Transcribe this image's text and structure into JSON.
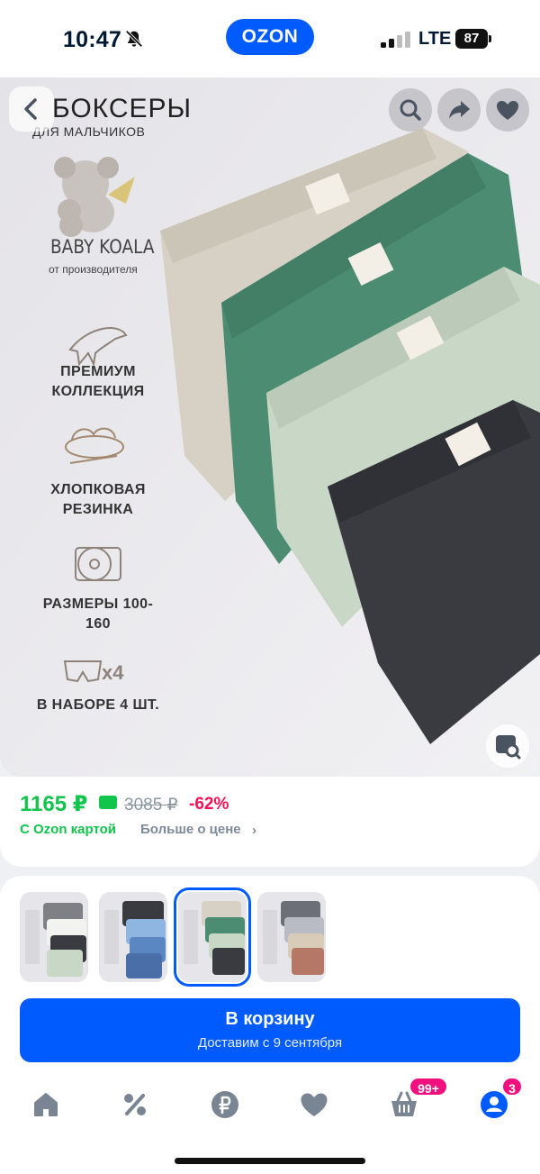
{
  "status_bar": {
    "time": "10:47",
    "network": "LTE",
    "battery": "87",
    "icons": [
      "bell-muted-icon",
      "signal-icon"
    ]
  },
  "app": {
    "logo_text": "OZON"
  },
  "gallery": {
    "title": "БОКСЕРЫ",
    "subtitle": "ДЛЯ МАЛЬЧИКОВ",
    "brand": "BABY KOALA",
    "brand_sub": "от производителя",
    "features": [
      {
        "text": "ПРЕМИУМ КОЛЛЕКЦИЯ",
        "icon": "dinosaur-icon"
      },
      {
        "text": "ХЛОПКОВАЯ РЕЗИНКА",
        "icon": "cotton-icon"
      },
      {
        "text": "РАЗМЕРЫ 100-160",
        "icon": "measuring-tape-icon"
      },
      {
        "text": "В НАБОРЕ 4 ШТ.",
        "icon": "briefs-icon",
        "count_label": "x4"
      }
    ],
    "product_colors": [
      "#d6d1c4",
      "#4b8c72",
      "#c9d7c6",
      "#3a3b40"
    ],
    "actions": [
      "back-icon",
      "search-icon",
      "share-icon",
      "heart-icon",
      "visual-search-icon"
    ]
  },
  "price": {
    "current": "1165 ₽",
    "old": "3085 ₽",
    "discount": "-62%",
    "card_label": "С Ozon картой",
    "more_label": "Больше о цене",
    "colors": {
      "ozon_green": "#10c44c",
      "discount_red": "#f91155"
    }
  },
  "variants": {
    "items": [
      {
        "colors": [
          "#7e8086",
          "#f2f2f0",
          "#c9d7c6",
          "#3a3b40"
        ]
      },
      {
        "colors": [
          "#3a3b40",
          "#8fb6e0",
          "#5a86c2",
          "#4a6fa8"
        ]
      },
      {
        "colors": [
          "#d6d1c4",
          "#4b8c72",
          "#c9d7c6",
          "#3a3b40"
        ],
        "selected": true
      },
      {
        "colors": [
          "#6d6f78",
          "#b9bcc4",
          "#d8cbb8",
          "#b57766"
        ]
      }
    ]
  },
  "cart": {
    "title": "В корзину",
    "subtitle": "Доставим с 9 сентября",
    "accent": "#005bff"
  },
  "tabbar": {
    "items": [
      {
        "icon": "home-icon"
      },
      {
        "icon": "percent-icon"
      },
      {
        "icon": "ruble-icon"
      },
      {
        "icon": "heart-icon"
      },
      {
        "icon": "basket-icon",
        "badge": "99+"
      },
      {
        "icon": "profile-icon",
        "badge": "3"
      }
    ],
    "badge_color": "#f1117e"
  }
}
